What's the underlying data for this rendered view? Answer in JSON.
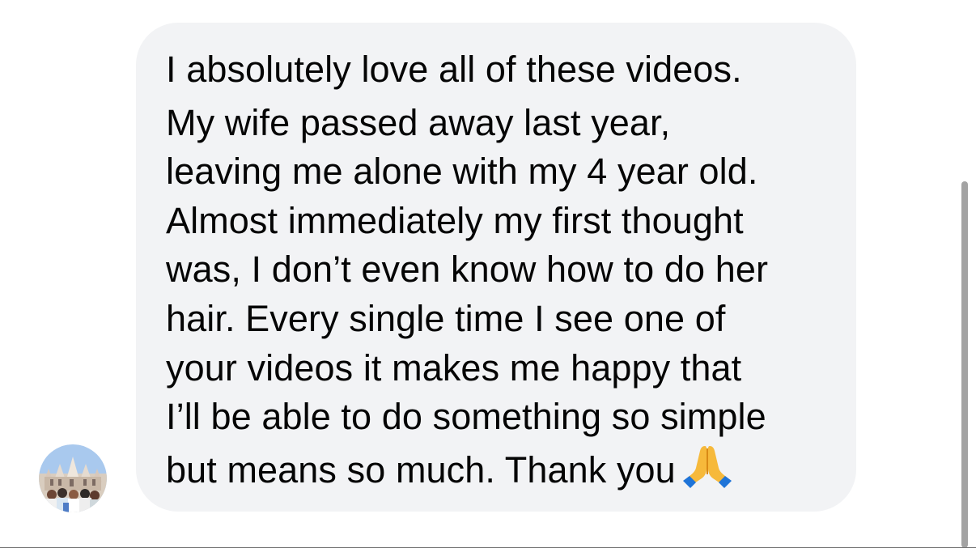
{
  "message": {
    "lines": [
      "I absolutely love all of these videos.",
      "My wife passed away last year,",
      "leaving me alone with my 4 year old.",
      "Almost immediately my first thought",
      "was, I don’t even know how to do her",
      "hair. Every single time I see one of",
      "your videos it makes me happy that",
      "I’ll be able to do something so simple",
      "but means so much. Thank you"
    ],
    "emoji_icon": "folded-hands-icon"
  },
  "avatar": {
    "icon": "avatar-photo"
  },
  "colors": {
    "bubble_background": "#f2f3f5",
    "text": "#050505",
    "scrollbar": "#a3a3a3"
  }
}
